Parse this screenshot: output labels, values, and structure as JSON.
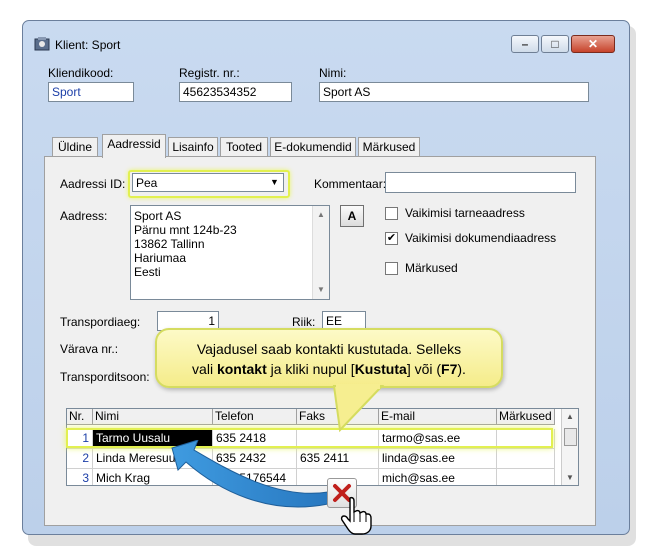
{
  "window": {
    "title": "Klient: Sport"
  },
  "header": {
    "kliendikood_label": "Kliendikood:",
    "kliendikood_value": "Sport",
    "registr_label": "Registr. nr.:",
    "registr_value": "45623534352",
    "nimi_label": "Nimi:",
    "nimi_value": "Sport AS"
  },
  "tabs": [
    {
      "label": "Üldine"
    },
    {
      "label": "Aadressid"
    },
    {
      "label": "Lisainfo"
    },
    {
      "label": "Tooted"
    },
    {
      "label": "E-dokumendid"
    },
    {
      "label": "Märkused"
    }
  ],
  "address": {
    "id_label": "Aadressi ID:",
    "id_value": "Pea",
    "comment_label": "Kommentaar:",
    "comment_value": "",
    "address_label": "Aadress:",
    "address_lines": [
      "Sport AS",
      "Pärnu mnt 124b-23",
      "13862 Tallinn",
      "Hariumaa",
      "Eesti"
    ],
    "a_button": "A",
    "cb_delivery": "Vaikimisi tarneaadress",
    "cb_document": "Vaikimisi dokumendiaadress",
    "cb_notes": "Märkused",
    "transport_days_label": "Transpordiaeg:",
    "transport_days_value": "1",
    "country_label": "Riik:",
    "country_value": "EE",
    "gate_label": "Värava nr.:",
    "transport_zone_label": "Transporditsoon:"
  },
  "callout": {
    "line1": "Vajadusel saab kontakti kustutada. Selleks",
    "line2_a": "vali ",
    "line2_b": "kontakt",
    "line2_c": " ja kliki nupul [",
    "line2_d": "Kustuta",
    "line2_e": "] või (",
    "line2_f": "F7",
    "line2_g": ")."
  },
  "contacts": {
    "columns": [
      "Nr.",
      "Nimi",
      "Telefon",
      "Faks",
      "E-mail",
      "Märkused"
    ],
    "rows": [
      {
        "nr": "1",
        "nimi": "Tarmo Uusalu",
        "telefon": "635 2418",
        "faks": "",
        "email": "tarmo@sas.ee",
        "markused": ""
      },
      {
        "nr": "2",
        "nimi": "Linda Meresuu",
        "telefon": "635 2432",
        "faks": "635 2411",
        "email": "linda@sas.ee",
        "markused": ""
      },
      {
        "nr": "3",
        "nimi": "Mich Krag",
        "telefon": "372 5176544",
        "faks": "",
        "email": "mich@sas.ee",
        "markused": ""
      }
    ]
  },
  "icons": {
    "app": "client-app-icon",
    "delete": "delete-x-icon",
    "cursor": "hand-cursor-icon",
    "arrow": "curved-arrow-icon"
  },
  "colors": {
    "highlight": "#e2f050",
    "callout_bg": "#f8f0a0",
    "delete_red": "#c0201c",
    "arrow_blue": "#3a8fd6"
  }
}
